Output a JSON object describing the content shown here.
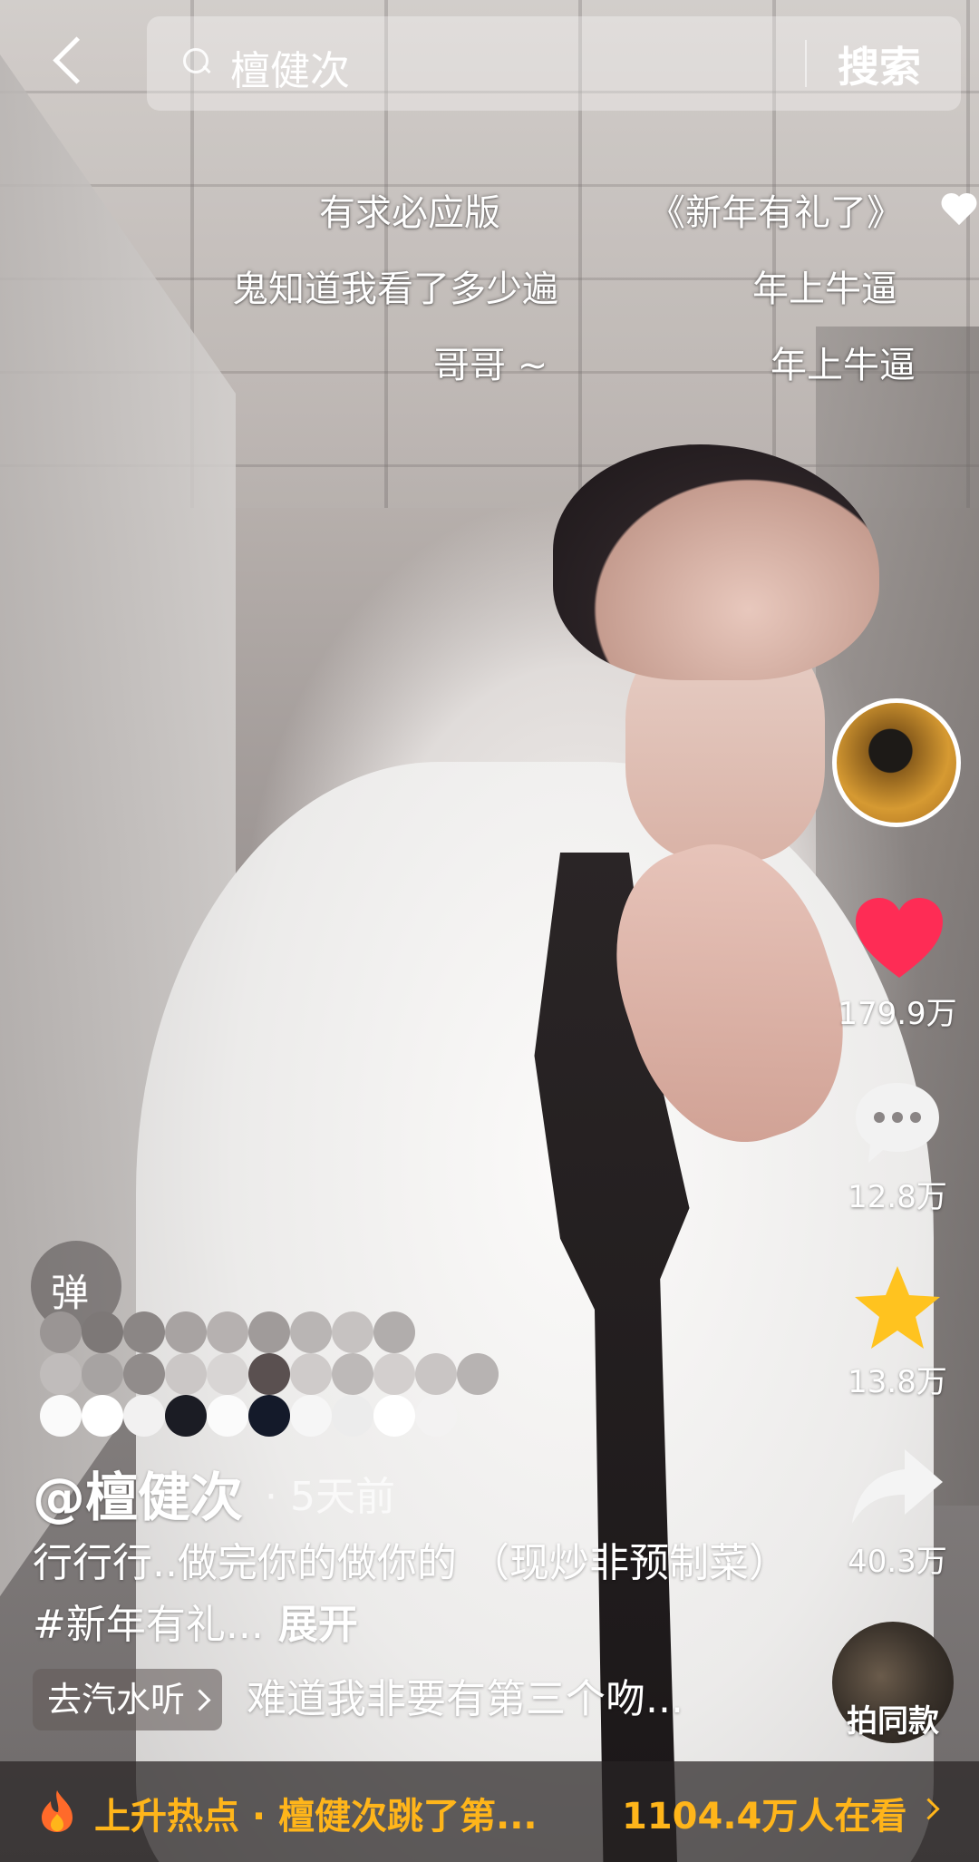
{
  "search": {
    "query": "檀健次",
    "button_label": "搜索"
  },
  "danmaku": {
    "row1_left": "有求必应版",
    "row1_right": "《新年有礼了》",
    "row2_left": "鬼知道我看了多少遍",
    "row2_right": "年上牛逼",
    "row3_left": "哥哥 ~",
    "row3_right": "年上牛逼",
    "toggle_label": "弹"
  },
  "actions": {
    "likes": "179.9万",
    "comments": "12.8万",
    "favorites": "13.8万",
    "shares": "40.3万",
    "like_color": "#fe2c55",
    "favorite_color": "#ffc31f"
  },
  "post": {
    "author": "@檀健次",
    "time": "· 5天前",
    "caption": "行行行..做完你的做你的 （现炒非预制菜）#新年有礼...",
    "expand_label": "展开"
  },
  "music": {
    "chip_label": "去汽水听",
    "title": "难道我非要有第三个吻..."
  },
  "same_style": {
    "label": "拍同款"
  },
  "hot_bar": {
    "text": "上升热点 · 檀健次跳了第...",
    "viewers": "1104.4万人在看",
    "accent_color": "#ffb51a"
  }
}
